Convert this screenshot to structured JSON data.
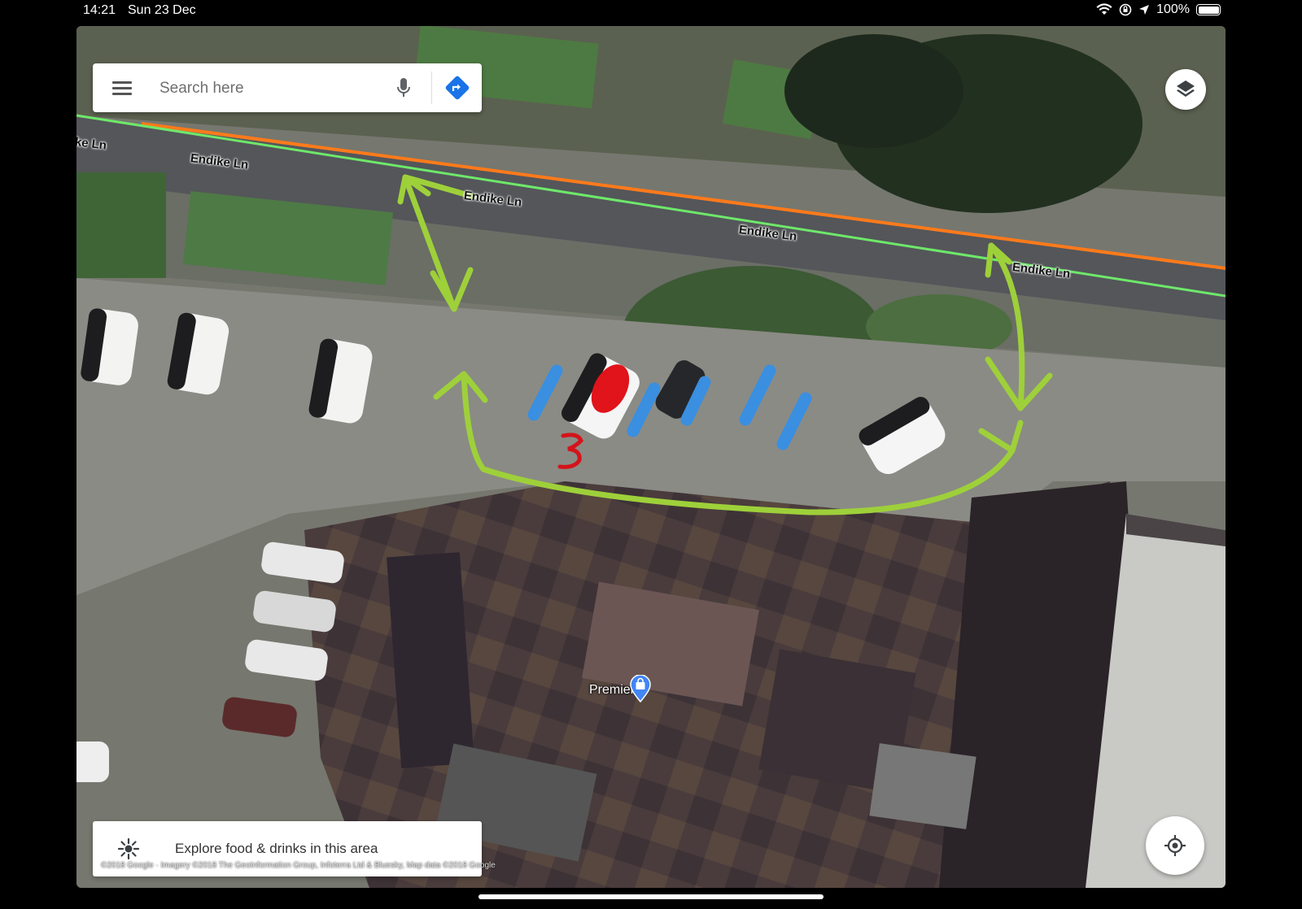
{
  "status_bar": {
    "time": "14:21",
    "date": "Sun 23 Dec",
    "battery": "100%",
    "battery_level": 1.0
  },
  "search": {
    "placeholder": "Search here",
    "menu_icon": "hamburger-menu-icon",
    "mic_icon": "microphone-icon",
    "directions_icon": "directions-icon"
  },
  "map": {
    "road_labels": [
      "ke Ln",
      "Endike Ln",
      "Endike Ln",
      "Endike Ln",
      "Endike Ln"
    ],
    "poi": {
      "name": "Premier",
      "icon": "shopping-bag-pin-icon"
    },
    "attribution": "©2018 Google · Imagery ©2018 The GeoInformation Group, Infoterra Ltd & Bluesky, Map data ©2018 Google",
    "annotation_number": "3",
    "colors": {
      "road_green": "#6ee86a",
      "road_orange": "#ff7a1a",
      "arrow_green": "#9ed03a",
      "marker_blue": "#3a8fe0",
      "marker_red": "#e0141a",
      "directions_blue": "#1a73e8"
    }
  },
  "layers_button": {
    "icon": "layers-icon"
  },
  "locate_button": {
    "icon": "my-location-icon"
  },
  "explore": {
    "label": "Explore food & drinks in this area",
    "icon": "explore-icon"
  }
}
